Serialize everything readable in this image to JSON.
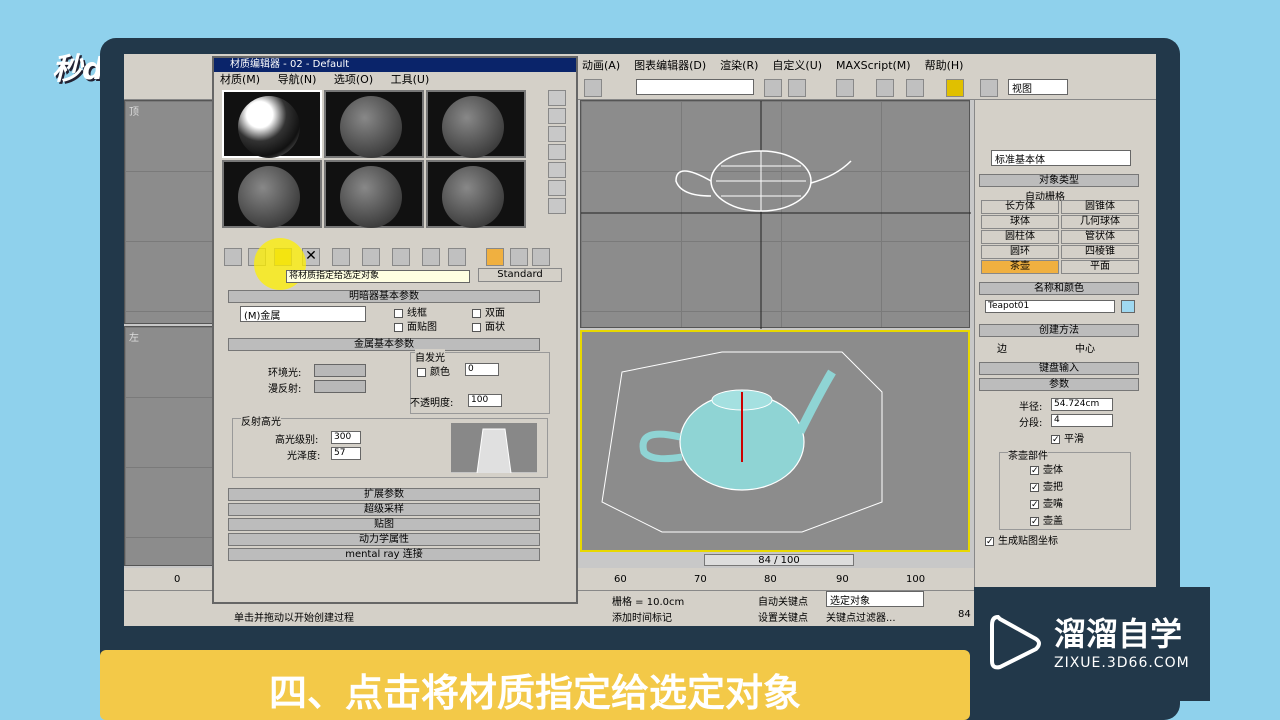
{
  "brand_top_left": "秒dong视频",
  "brand_bottom_right": {
    "name": "溜溜自学",
    "url": "ZIXUE.3D66.COM"
  },
  "caption": "四、点击将材质指定给选定对象",
  "menubar": [
    "动画(A)",
    "图表编辑器(D)",
    "渲染(R)",
    "自定义(U)",
    "MAXScript(M)",
    "帮助(H)"
  ],
  "toolbar": {
    "view_combo": "视图"
  },
  "viewports": {
    "top": "顶",
    "left": "左"
  },
  "timeline": {
    "frame": "84 / 100",
    "ticks": [
      "0",
      "60",
      "70",
      "80",
      "90",
      "100"
    ]
  },
  "status": {
    "hint": "单击并拖动以开始创建过程",
    "grid": "栅格 = 10.0cm",
    "add_time_tag": "添加时间标记",
    "auto_key": "自动关键点",
    "set_key": "设置关键点",
    "selected": "选定对象",
    "key_filters": "关键点过滤器...",
    "frame_num": "84"
  },
  "material_editor": {
    "title": "材质编辑器 - 02 - Default",
    "menu": [
      "材质(M)",
      "导航(N)",
      "选项(O)",
      "工具(U)"
    ],
    "tooltip": "将材质指定给选定对象",
    "type_button": "Standard",
    "shader_rollout": "明暗器基本参数",
    "shader_type": "(M)金属",
    "checks": [
      "线框",
      "双面",
      "面贴图",
      "面状"
    ],
    "metal_rollout": "金属基本参数",
    "self_illum": "自发光",
    "color_label": "颜色",
    "self_illum_val": "0",
    "ambient": "环境光:",
    "diffuse": "漫反射:",
    "opacity": "不透明度:",
    "opacity_val": "100",
    "specular": "反射高光",
    "spec_level": "高光级别:",
    "spec_level_val": "300",
    "gloss": "光泽度:",
    "gloss_val": "57",
    "rollouts": [
      "扩展参数",
      "超级采样",
      "贴图",
      "动力学属性",
      "mental ray 连接"
    ]
  },
  "command_panel": {
    "category": "标准基本体",
    "object_type": "对象类型",
    "auto_grid": "自动栅格",
    "objects": [
      "长方体",
      "圆锥体",
      "球体",
      "几何球体",
      "圆柱体",
      "管状体",
      "圆环",
      "四棱锥",
      "茶壶",
      "平面"
    ],
    "name_color": "名称和颜色",
    "name": "Teapot01",
    "creation_method": "创建方法",
    "edge": "边",
    "center": "中心",
    "keyboard": "键盘输入",
    "params": "参数",
    "radius_label": "半径:",
    "radius": "54.724cm",
    "segments_label": "分段:",
    "segments": "4",
    "smooth": "平滑",
    "parts": "茶壶部件",
    "part_items": [
      "壶体",
      "壶把",
      "壶嘴",
      "壶盖"
    ],
    "gen_uv": "生成贴图坐标"
  },
  "colors": {
    "accent": "#f3c948",
    "frame": "#22384a",
    "bg": "#8fd1ec",
    "teapot": "#8fd4d4"
  }
}
